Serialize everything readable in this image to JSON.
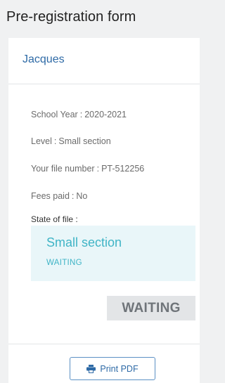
{
  "page": {
    "title": "Pre-registration form"
  },
  "card": {
    "title": "Jacques",
    "fields": {
      "school_year": {
        "label": "School Year",
        "value": "2020-2021"
      },
      "level": {
        "label": "Level",
        "value": "Small section"
      },
      "file_number": {
        "label": "Your file number",
        "value": "PT-512256"
      },
      "fees_paid": {
        "label": "Fees paid",
        "value": "No"
      }
    },
    "state": {
      "label": "State of file :",
      "level": "Small section",
      "status": "WAITING"
    },
    "status_badge": "WAITING",
    "print_button": {
      "label": "Print PDF",
      "icon": "printer-icon"
    }
  },
  "colors": {
    "accent_blue": "#2e6aa6",
    "state_teal": "#3fb4c6",
    "state_bg": "#e9f6f9",
    "badge_bg": "#e3e5e7"
  }
}
